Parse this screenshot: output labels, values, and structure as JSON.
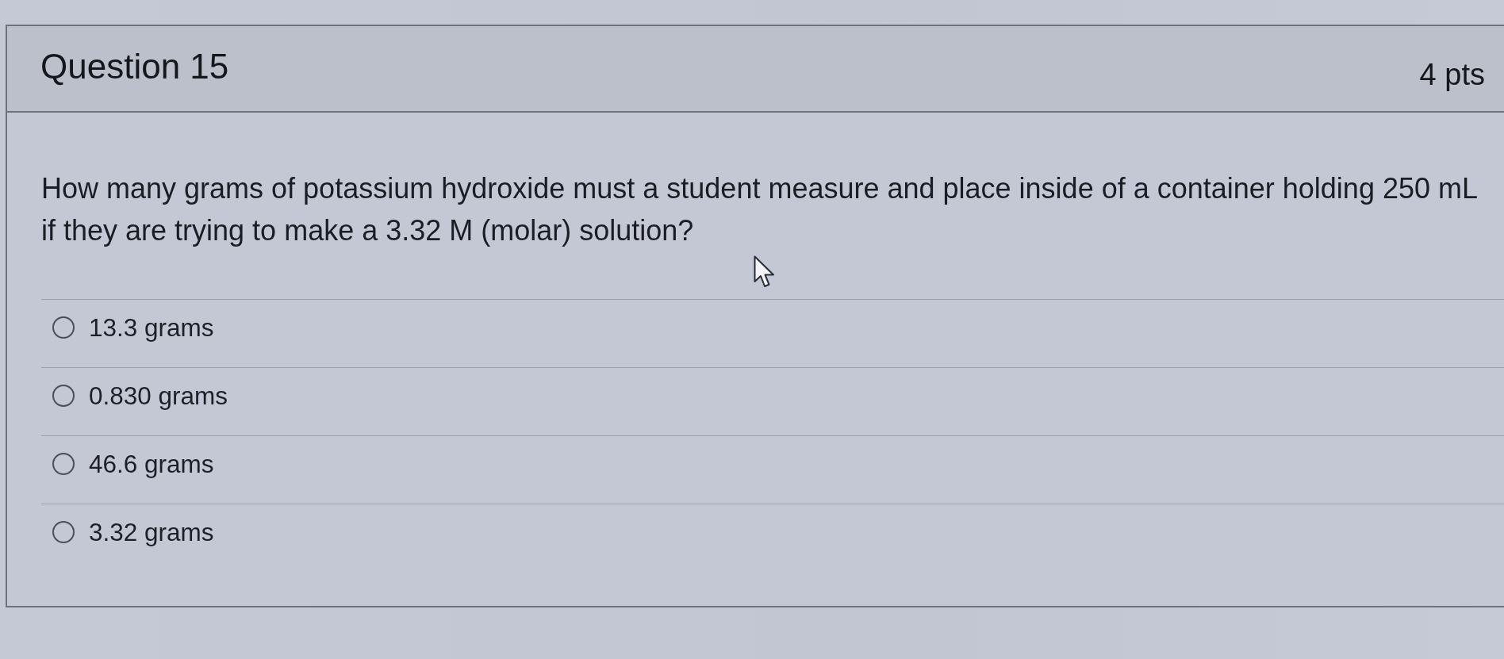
{
  "question": {
    "title": "Question 15",
    "points": "4 pts"
  },
  "prompt": "How many grams of potassium hydroxide must a student measure and place inside of a container holding 250 mL if they are trying to make a 3.32 M (molar) solution?",
  "options": [
    {
      "label": "13.3 grams",
      "selected": false
    },
    {
      "label": "0.830 grams",
      "selected": false
    },
    {
      "label": "46.6 grams",
      "selected": false
    },
    {
      "label": "3.32 grams",
      "selected": false
    }
  ]
}
